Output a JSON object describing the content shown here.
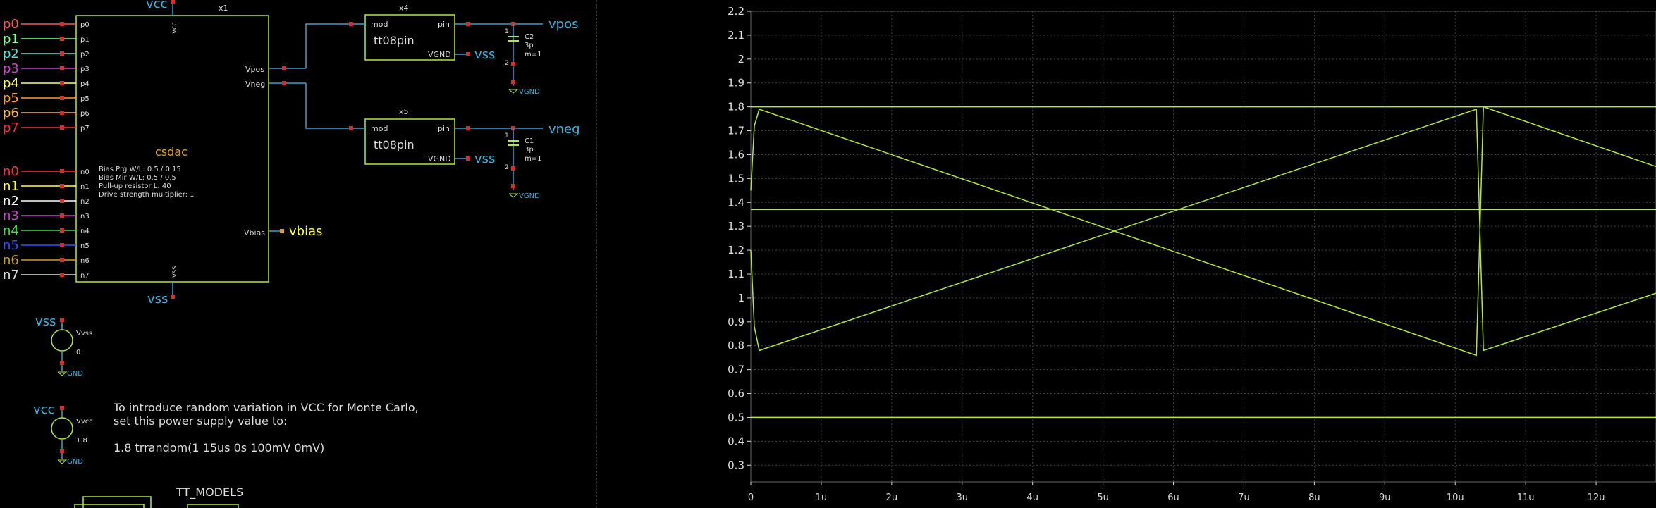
{
  "schematic": {
    "vcc_top_label": "vcc",
    "vss_bottom_label": "vss",
    "inst_x1": "x1",
    "inst_x4": "x4",
    "inst_x5": "x5",
    "block_name": "csdac",
    "block_pin_vcc": "vcc",
    "block_pin_vss": "vss",
    "block_pin_vpos": "Vpos",
    "block_pin_vneg": "Vneg",
    "block_pin_vbias": "Vbias",
    "params": [
      "Bias Prg W/L: 0.5 / 0.15",
      "Bias Mir W/L: 0.5 / 0.5",
      "Pull-up resistor L: 40",
      "Drive strength multiplier: 1"
    ],
    "p_ports": [
      {
        "label": "p0",
        "pin": "p0",
        "color": "#ff5555"
      },
      {
        "label": "p1",
        "pin": "p1",
        "color": "#7fff7f"
      },
      {
        "label": "p2",
        "pin": "p2",
        "color": "#5fe0d0"
      },
      {
        "label": "p3",
        "pin": "p3",
        "color": "#d040d0"
      },
      {
        "label": "p4",
        "pin": "p4",
        "color": "#ffff70"
      },
      {
        "label": "p5",
        "pin": "p5",
        "color": "#ff9933"
      },
      {
        "label": "p6",
        "pin": "p6",
        "color": "#ffb347"
      },
      {
        "label": "p7",
        "pin": "p7",
        "color": "#ff3030"
      }
    ],
    "n_ports": [
      {
        "label": "n0",
        "pin": "n0",
        "color": "#ff3030"
      },
      {
        "label": "n1",
        "pin": "n1",
        "color": "#ffff40"
      },
      {
        "label": "n2",
        "pin": "n2",
        "color": "#ffffff"
      },
      {
        "label": "n3",
        "pin": "n3",
        "color": "#d040d0"
      },
      {
        "label": "n4",
        "pin": "n4",
        "color": "#40e040"
      },
      {
        "label": "n5",
        "pin": "n5",
        "color": "#3050ff"
      },
      {
        "label": "n6",
        "pin": "n6",
        "color": "#d0a020"
      },
      {
        "label": "n7",
        "pin": "n7",
        "color": "#e0e0e0"
      }
    ],
    "vbias_label": "vbias",
    "tt08pin": {
      "name": "tt08pin",
      "pin_mod": "mod",
      "pin_pin": "pin",
      "pin_vgnd": "VGND"
    },
    "vpos_label": "vpos",
    "vneg_label": "vneg",
    "vss_label": "vss",
    "cap_c2": {
      "name": "C2",
      "value": "3p",
      "mult": "m=1",
      "pin1": "1",
      "pin2": "2",
      "gnd": "VGND"
    },
    "cap_c1": {
      "name": "C1",
      "value": "3p",
      "mult": "m=1",
      "pin1": "1",
      "pin2": "2",
      "gnd": "VGND"
    },
    "vvss": {
      "net": "vss",
      "name": "Vvss",
      "value": "0",
      "gnd": "GND"
    },
    "vvcc": {
      "net": "vcc",
      "name": "Vvcc",
      "value": "1.8",
      "gnd": "GND"
    },
    "note_line1": "To introduce random variation in VCC for Monte Carlo,",
    "note_line2": "set this power supply value to:",
    "note_line3": "1.8 trrandom(1 15us 0s 100mV 0mV)",
    "tt_models": "TT_MODELS"
  },
  "chart_data": {
    "type": "line",
    "xlabel": "",
    "ylabel": "",
    "x_tick_labels": [
      "0",
      "1u",
      "2u",
      "3u",
      "4u",
      "5u",
      "6u",
      "7u",
      "8u",
      "9u",
      "10u",
      "11u",
      "12u"
    ],
    "y_tick_labels": [
      "0.3",
      "0.4",
      "0.5",
      "0.6",
      "0.7",
      "0.8",
      "0.9",
      "1",
      "1.1",
      "1.2",
      "1.3",
      "1.4",
      "1.5",
      "1.6",
      "1.7",
      "1.8",
      "1.9",
      "2",
      "2.1",
      "2.2"
    ],
    "xlim": [
      0,
      12.85
    ],
    "ylim": [
      0.23,
      2.2
    ],
    "x_unit": "us",
    "grid": true,
    "series": [
      {
        "points": [
          [
            0,
            1.8
          ],
          [
            12.85,
            1.8
          ]
        ]
      },
      {
        "points": [
          [
            0,
            1.37
          ],
          [
            12.85,
            1.37
          ]
        ]
      },
      {
        "points": [
          [
            0,
            0.5
          ],
          [
            12.85,
            0.5
          ]
        ]
      },
      {
        "points": [
          [
            0,
            1.45
          ],
          [
            0.05,
            1.72
          ],
          [
            0.12,
            1.79
          ],
          [
            10.3,
            0.76
          ],
          [
            10.4,
            1.8
          ],
          [
            12.85,
            1.55
          ]
        ]
      },
      {
        "points": [
          [
            0,
            1.2
          ],
          [
            0.05,
            0.88
          ],
          [
            0.12,
            0.78
          ],
          [
            10.3,
            1.79
          ],
          [
            10.4,
            0.78
          ],
          [
            12.85,
            1.02
          ]
        ]
      }
    ],
    "colors": {
      "trace": "#b3e834",
      "grid": "#444444",
      "axis": "#dddddd"
    }
  }
}
